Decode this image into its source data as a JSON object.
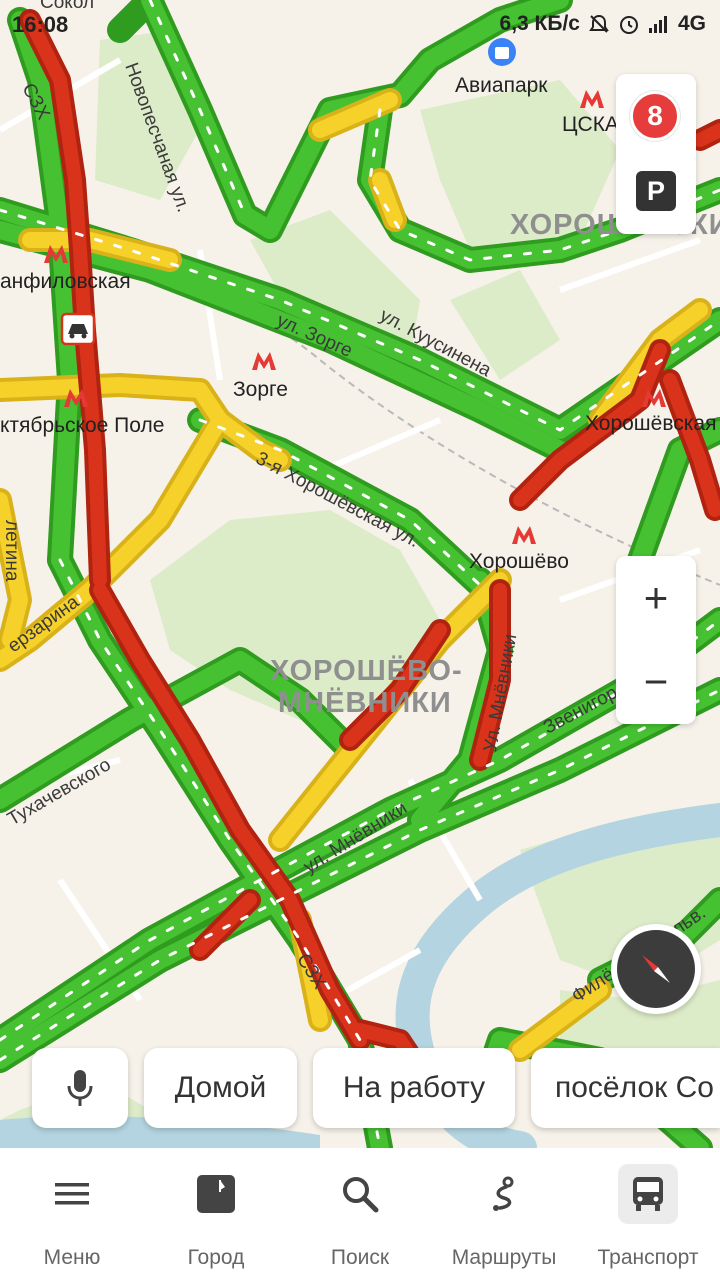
{
  "status_bar": {
    "time": "16:08",
    "net_speed": "6,3 КБ/с",
    "network": "4G"
  },
  "map": {
    "streets": {
      "sokol": "Сокол",
      "novopeschanaya": "Новопесчаная ул.",
      "szh_top": "СЗХ",
      "szh_bottom": "СЗХ",
      "zorge": "ул. Зорге",
      "kuusinena": "ул. Куусинена",
      "khoroshevskaya3": "3-я Хорошёвская ул.",
      "mnevniki_ul": "Ул. Мнёвники",
      "mnevniki": "ул. Мнёвники",
      "zvenigorodskoe": "Звенигородское ш.",
      "tukhachevskogo": "Тухачевского",
      "berzarina": "ерзарина",
      "vyaltina": "летина",
      "filevsky": "Филёвский бульв."
    },
    "districts": {
      "khoroshevsky": "ХОРОШЁВСКИЙ",
      "mnevniki_line1": "ХОРОШЁВО-",
      "mnevniki_line2": "МНЁВНИКИ"
    },
    "stations": {
      "aviapark": "Авиапарк",
      "cska": "ЦСКА",
      "panfilovskaya": "анфиловская",
      "zorge": "Зорге",
      "oktyabrskoe_pole": "ктябрьское Поле",
      "khoroshevskaya": "Хорошёвская",
      "khoroshevo": "Хорошёво"
    }
  },
  "traffic": {
    "score": "8"
  },
  "parking": {
    "label": "P"
  },
  "zoom": {
    "in_label": "+",
    "out_label": "−"
  },
  "quick_chips": {
    "home": "Домой",
    "work": "На работу",
    "settlement": "посёлок Со"
  },
  "nav": [
    {
      "label": "Меню",
      "icon": "menu-icon"
    },
    {
      "label": "Город",
      "icon": "city-icon"
    },
    {
      "label": "Поиск",
      "icon": "search-icon"
    },
    {
      "label": "Маршруты",
      "icon": "routes-icon"
    },
    {
      "label": "Транспорт",
      "icon": "bus-icon"
    }
  ],
  "colors": {
    "traffic_green": "#3bb027",
    "traffic_yellow": "#f5d12a",
    "traffic_red": "#d9331b",
    "metro": "#e53935",
    "water": "#b3d4e0",
    "park": "#dcebc8"
  }
}
